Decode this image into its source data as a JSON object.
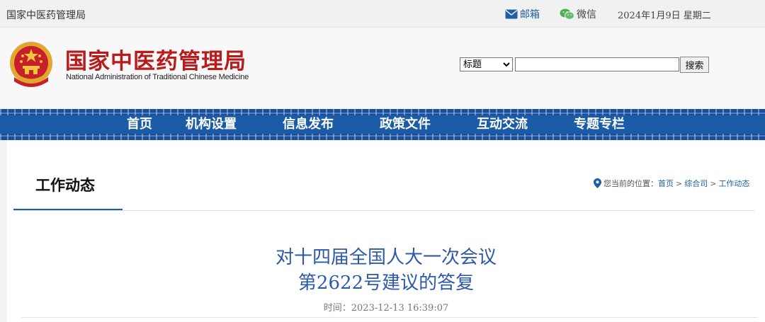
{
  "topbar": {
    "site_name": "国家中医药管理局",
    "mail_label": "邮箱",
    "wechat_label": "微信",
    "date": "2024年1月9日 星期二"
  },
  "header": {
    "logo_cn": "国家中医药管理局",
    "logo_en": "National Administration of Traditional Chinese Medicine",
    "search": {
      "type_options": [
        "标题"
      ],
      "type_selected": "标题",
      "input_value": "",
      "button_label": "搜索"
    }
  },
  "nav": {
    "items": [
      "首页",
      "机构设置",
      "信息发布",
      "政策文件",
      "互动交流",
      "专题专栏"
    ]
  },
  "section": {
    "title": "工作动态",
    "breadcrumb": {
      "prefix": "您当前的位置：",
      "items": [
        "首页",
        "综合司",
        "工作动态"
      ],
      "separator": ">"
    }
  },
  "article": {
    "title_line1": "对十四届全国人大一次会议",
    "title_line2": "第2622号建议的答复",
    "time_label": "时间：",
    "time_value": "2023-12-13 16:39:07"
  },
  "colors": {
    "brand_red": "#b91b1b",
    "nav_blue": "#1c5ba6",
    "title_blue": "#2d5aa8",
    "link_blue": "#1f5ea8",
    "wechat_green": "#4caf50"
  },
  "icons": [
    "mail-icon",
    "wechat-icon",
    "national-emblem",
    "location-pin-icon"
  ]
}
